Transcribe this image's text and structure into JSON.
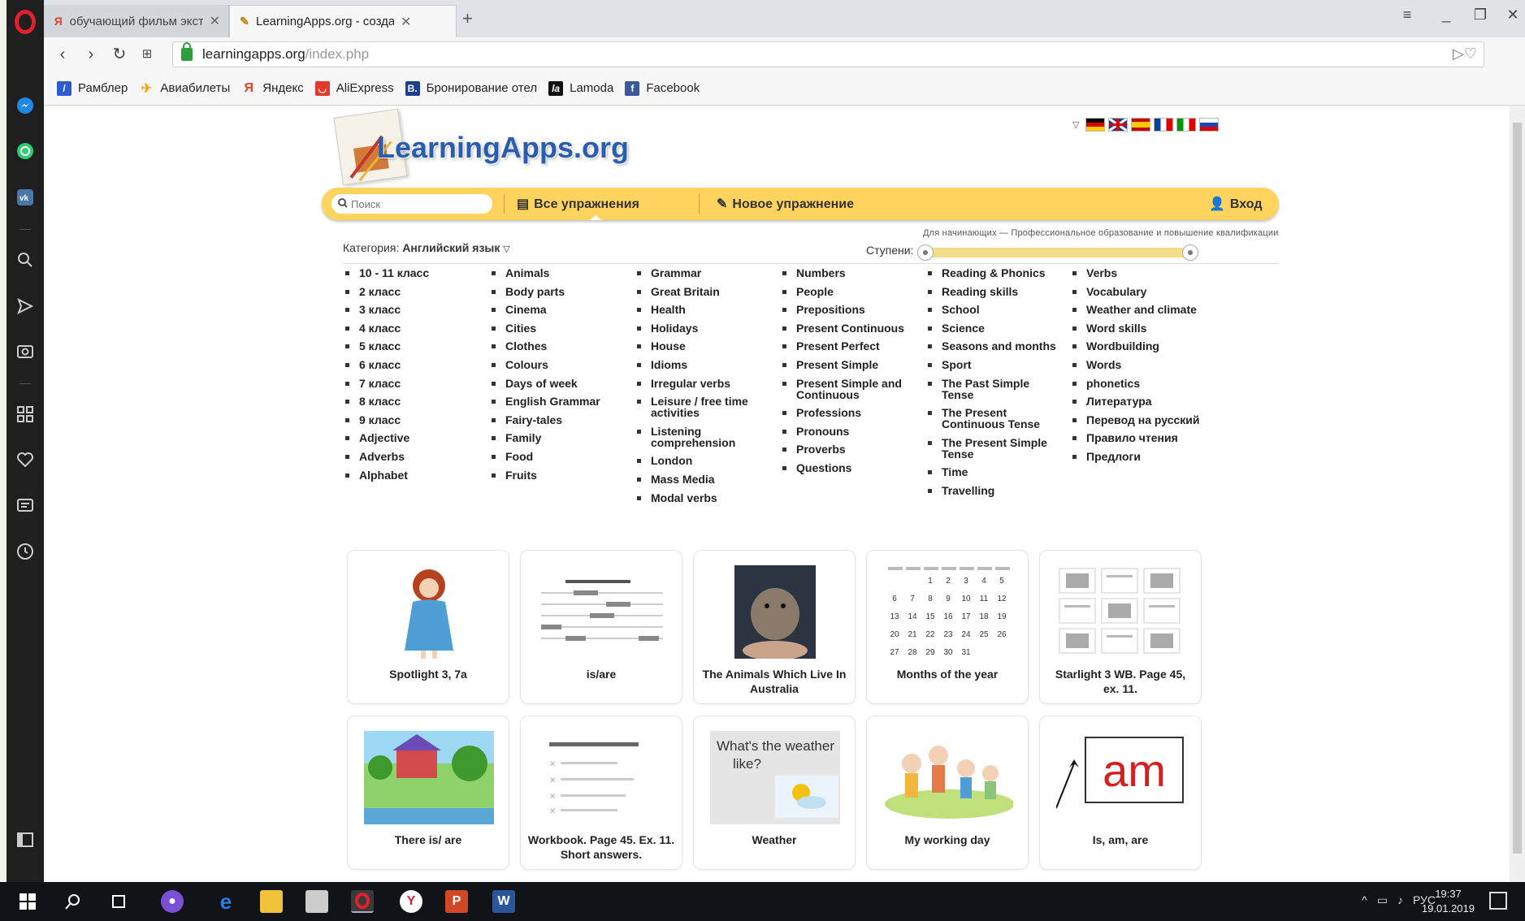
{
  "browser": {
    "tabs": [
      {
        "title": "обучающий фильм экстр",
        "favicon": "Я",
        "active": false
      },
      {
        "title": "LearningApps.org - созда",
        "favicon": "la",
        "active": true
      }
    ],
    "url_host": "learningapps.org",
    "url_path": "/index.php",
    "bookmarks": [
      {
        "label": "Рамблер",
        "icon": "/",
        "color": "#2f5bd1"
      },
      {
        "label": "Авиабилеты",
        "icon": "✈",
        "color": "#f1a31b"
      },
      {
        "label": "Яндекс",
        "icon": "Я",
        "color": "#e8412d"
      },
      {
        "label": "AliExpress",
        "icon": "◡",
        "color": "#e4382c"
      },
      {
        "label": "Бронирование отел",
        "icon": "B.",
        "color": "#1e3f8f"
      },
      {
        "label": "Lamoda",
        "icon": "la",
        "color": "#111111"
      },
      {
        "label": "Facebook",
        "icon": "f",
        "color": "#3b5998"
      }
    ]
  },
  "site": {
    "logo_text": "LearningApps.org",
    "menu": {
      "search_placeholder": "Поиск",
      "all_exercises": "Все упражнения",
      "new_exercise": "Новое упражнение",
      "login": "Вход"
    },
    "levels_caption": "Для начинающих — Профессиональное образование и повышение квалификации",
    "category_label": "Категория:",
    "category_value": "Английский язык",
    "levels_label": "Ступени:",
    "level_range": [
      0,
      1
    ]
  },
  "categories": [
    [
      "10 - 11 класс",
      "2 класс",
      "3 класс",
      "4 класс",
      "5 класс",
      "6 класс",
      "7 класс",
      "8 класс",
      "9 класс",
      "Adjective",
      "Adverbs",
      "Alphabet"
    ],
    [
      "Animals",
      "Body parts",
      "Cinema",
      "Cities",
      "Clothes",
      "Colours",
      "Days of week",
      "English Grammar",
      "Fairy-tales",
      "Family",
      "Food",
      "Fruits"
    ],
    [
      "Grammar",
      "Great Britain",
      "Health",
      "Holidays",
      "House",
      "Idioms",
      "Irregular verbs",
      "Leisure / free time activities",
      "Listening comprehension",
      "London",
      "Mass Media",
      "Modal verbs"
    ],
    [
      "Numbers",
      "People",
      "Prepositions",
      "Present Continuous",
      "Present Perfect",
      "Present Simple",
      "Present Simple and Continuous",
      "Professions",
      "Pronouns",
      "Proverbs",
      "Questions"
    ],
    [
      "Reading & Phonics",
      "Reading skills",
      "School",
      "Science",
      "Seasons and months",
      "Sport",
      "The Past Simple Tense",
      "The Present Continuous Tense",
      "The Present Simple Tense",
      "Time",
      "Travelling"
    ],
    [
      "Verbs",
      "Vocabulary",
      "Weather and climate",
      "Word skills",
      "Wordbuilding",
      "Words",
      "phonetics",
      "Литература",
      "Перевод на русский",
      "Правило чтения",
      "Предлоги"
    ]
  ],
  "cards": [
    {
      "title": "Spotlight 3, 7a",
      "thumb": "doll"
    },
    {
      "title": "is/are",
      "thumb": "lines"
    },
    {
      "title": "The Animals Which Live In Australia",
      "thumb": "wombat"
    },
    {
      "title": "Months of the year",
      "thumb": "calendar"
    },
    {
      "title": "Starlight 3 WB. Page 45, ex. 11.",
      "thumb": "grid"
    },
    {
      "title": "There is/ are",
      "thumb": "village"
    },
    {
      "title": "Workbook. Page 45. Ex. 11. Short answers.",
      "thumb": "checklist"
    },
    {
      "title": "Weather",
      "thumb": "weather",
      "thumb_text": "What's the weather like?"
    },
    {
      "title": "My working day",
      "thumb": "kids"
    },
    {
      "title": "Is, am, are",
      "thumb": "am",
      "thumb_text": "am"
    }
  ],
  "calendar": {
    "rows": [
      [
        "",
        "",
        "1",
        "2",
        "3",
        "4",
        "5"
      ],
      [
        "6",
        "7",
        "8",
        "9",
        "10",
        "11",
        "12"
      ],
      [
        "13",
        "14",
        "15",
        "16",
        "17",
        "18",
        "19"
      ],
      [
        "20",
        "21",
        "22",
        "23",
        "24",
        "25",
        "26"
      ],
      [
        "27",
        "28",
        "29",
        "30",
        "31",
        "",
        ""
      ]
    ]
  },
  "taskbar": {
    "tray_lang": "РУС",
    "time": "19:37",
    "date": "19.01.2019"
  }
}
